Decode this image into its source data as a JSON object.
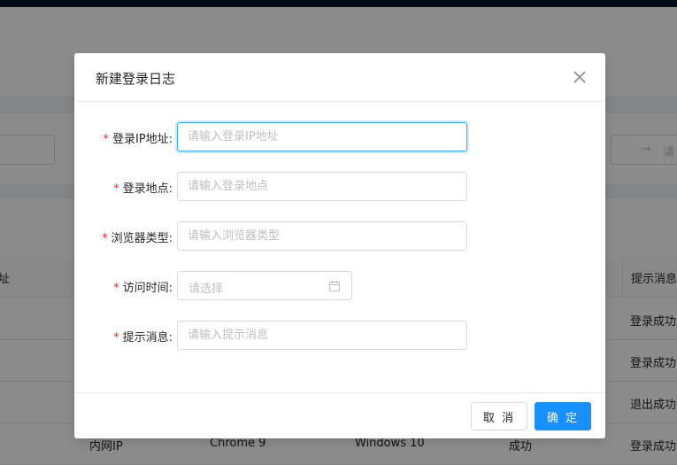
{
  "modal": {
    "title": "新建登录日志",
    "fields": [
      {
        "label": "登录IP地址:",
        "placeholder": "请输入登录IP地址",
        "required": true,
        "focused": true
      },
      {
        "label": "登录地点:",
        "placeholder": "请输入登录地点",
        "required": true
      },
      {
        "label": "浏览器类型:",
        "placeholder": "请输入浏览器类型",
        "required": true
      },
      {
        "label": "访问时间:",
        "placeholder": "请选择",
        "required": true,
        "type": "date",
        "icon": "calendar-icon"
      },
      {
        "label": "提示消息:",
        "placeholder": "请输入提示消息",
        "required": true
      }
    ],
    "required_mark": "*",
    "cancel_label": "取 消",
    "ok_label": "确 定",
    "close_icon": "close-icon"
  },
  "background": {
    "range_arrow": "→",
    "range_placeholder": "请",
    "table": {
      "left_header": "址",
      "right_header": "提示消息",
      "rows": [
        {
          "message": "登录成功"
        },
        {
          "message": "登录成功"
        },
        {
          "message": "退出成功"
        },
        {
          "ip": "内网IP",
          "browser": "Chrome 9",
          "os": "Windows 10",
          "status": "成功",
          "message": "登录成功"
        }
      ]
    }
  },
  "colors": {
    "primary": "#1890ff",
    "required": "#f5222d",
    "topbar": "#001529"
  }
}
